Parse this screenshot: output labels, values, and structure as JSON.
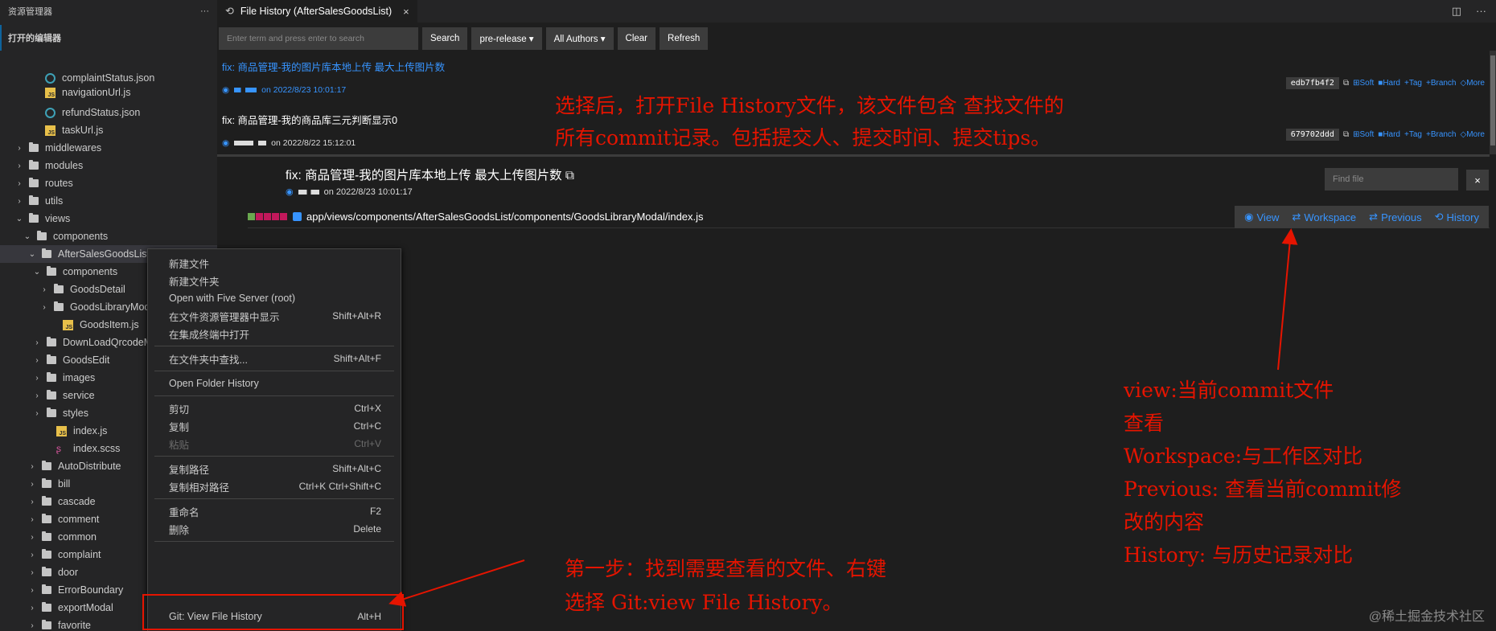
{
  "sidebar": {
    "header": "资源管理器",
    "header_more": "···",
    "open_editors": "打开的编辑器",
    "items": [
      {
        "label": "complaintStatus.json",
        "icon": "json-file-icon"
      },
      {
        "label": "navigationUrl.js",
        "icon": "js-file-icon"
      },
      {
        "label": "refundStatus.json",
        "icon": "json-file-icon"
      },
      {
        "label": "taskUrl.js",
        "icon": "js-file-icon"
      },
      {
        "label": "middlewares",
        "icon": "folder-icon"
      },
      {
        "label": "modules",
        "icon": "folder-icon"
      },
      {
        "label": "routes",
        "icon": "folder-icon"
      },
      {
        "label": "utils",
        "icon": "folder-icon"
      },
      {
        "label": "views",
        "icon": "folder-icon"
      },
      {
        "label": "components",
        "icon": "folder-icon"
      },
      {
        "label": "AfterSalesGoodsList",
        "icon": "folder-icon"
      },
      {
        "label": "components",
        "icon": "folder-icon"
      },
      {
        "label": "GoodsDetail",
        "icon": "folder-icon"
      },
      {
        "label": "GoodsLibraryModal",
        "icon": "folder-icon"
      },
      {
        "label": "GoodsItem.js",
        "icon": "js-file-icon"
      },
      {
        "label": "DownLoadQrcodeModal",
        "icon": "folder-icon"
      },
      {
        "label": "GoodsEdit",
        "icon": "folder-icon"
      },
      {
        "label": "images",
        "icon": "folder-icon"
      },
      {
        "label": "service",
        "icon": "folder-icon"
      },
      {
        "label": "styles",
        "icon": "folder-icon"
      },
      {
        "label": "index.js",
        "icon": "js-file-icon"
      },
      {
        "label": "index.scss",
        "icon": "scss-file-icon"
      },
      {
        "label": "AutoDistribute",
        "icon": "folder-icon"
      },
      {
        "label": "bill",
        "icon": "folder-icon"
      },
      {
        "label": "cascade",
        "icon": "folder-icon"
      },
      {
        "label": "comment",
        "icon": "folder-icon"
      },
      {
        "label": "common",
        "icon": "folder-icon"
      },
      {
        "label": "complaint",
        "icon": "folder-icon"
      },
      {
        "label": "door",
        "icon": "folder-icon"
      },
      {
        "label": "ErrorBoundary",
        "icon": "folder-icon"
      },
      {
        "label": "exportModal",
        "icon": "folder-icon"
      },
      {
        "label": "favorite",
        "icon": "folder-icon"
      }
    ]
  },
  "tab": {
    "title": "File History (AfterSalesGoodsList)",
    "close": "×"
  },
  "toolbar": {
    "search_placeholder": "Enter term and press enter to search",
    "search": "Search",
    "branch": "pre-release ▾",
    "authors": "All Authors ▾",
    "clear": "Clear",
    "refresh": "Refresh"
  },
  "commits": [
    {
      "message": "fix: 商品管理-我的图片库本地上传 最大上传图片数",
      "date": "on 2022/8/23 10:01:17",
      "hash": "edb7fb4f2"
    },
    {
      "message": "fix: 商品管理-我的商品库三元判断显示0",
      "date": "on 2022/8/22 15:12:01",
      "hash": "679702ddd"
    }
  ],
  "commit_actions": {
    "soft": "Soft",
    "hard": "Hard",
    "tag": "Tag",
    "branch": "Branch",
    "more": "More"
  },
  "detail": {
    "title": "fix: 商品管理-我的图片库本地上传 最大上传图片数",
    "date": "on 2022/8/23 10:01:17",
    "find_placeholder": "Find file",
    "find_close": "×",
    "file_path": "app/views/components/AfterSalesGoodsList/components/GoodsLibraryModal/index.js",
    "view": "View",
    "workspace": "Workspace",
    "previous": "Previous",
    "history": "History"
  },
  "context_menu": {
    "new_file": "新建文件",
    "new_folder": "新建文件夹",
    "five_server": "Open with Five Server (root)",
    "reveal": "在文件资源管理器中显示",
    "reveal_key": "Shift+Alt+R",
    "terminal": "在集成终端中打开",
    "find_in_folder": "在文件夹中查找...",
    "find_key": "Shift+Alt+F",
    "folder_history": "Open Folder History",
    "cut": "剪切",
    "cut_key": "Ctrl+X",
    "copy": "复制",
    "copy_key": "Ctrl+C",
    "paste": "粘贴",
    "paste_key": "Ctrl+V",
    "copy_path": "复制路径",
    "copy_path_key": "Shift+Alt+C",
    "copy_rel_path": "复制相对路径",
    "copy_rel_path_key": "Ctrl+K Ctrl+Shift+C",
    "rename": "重命名",
    "rename_key": "F2",
    "delete": "删除",
    "delete_key": "Delete",
    "git_history": "Git: View File History",
    "git_history_key": "Alt+H"
  },
  "annotations": {
    "top_line1": "选择后，打开File History文件，该文件包含 查找文件的",
    "top_line2": "所有commit记录。包括提交人、提交时间、提交tips。",
    "right_lines": [
      "view:当前commit文件",
      "查看",
      "Workspace:与工作区对比",
      "Previous: 查看当前commit修",
      "改的内容",
      "History: 与历史记录对比"
    ],
    "bottom_line1": "第一步：找到需要查看的文件、右键",
    "bottom_line2": "选择 Git:view File History。",
    "color": "#e51400"
  },
  "watermark": "@稀土掘金技术社区"
}
